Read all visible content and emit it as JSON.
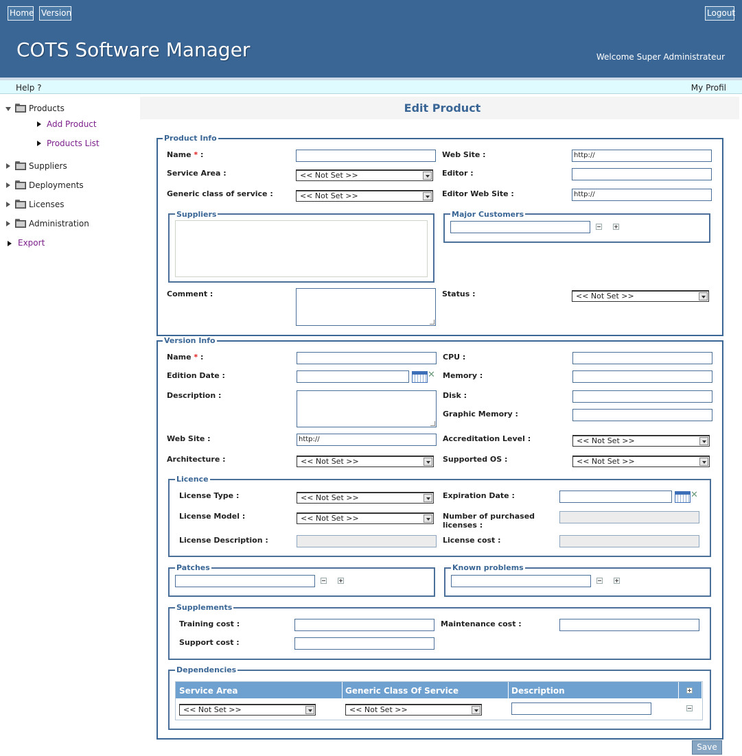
{
  "header": {
    "home_label": "Home",
    "version_label": "Version",
    "logout_label": "Logout",
    "app_title": "COTS Software Manager",
    "welcome_text": "Welcome Super Administrateur"
  },
  "subbar": {
    "help_label": "Help ?",
    "profile_label": "My Profil"
  },
  "sidebar": {
    "products": "Products",
    "add_product": "Add Product",
    "products_list": "Products List",
    "suppliers": "Suppliers",
    "deployments": "Deployments",
    "licenses": "Licenses",
    "administration": "Administration",
    "export": "Export"
  },
  "page_title": "Edit Product",
  "product_info": {
    "legend": "Product Info",
    "name_label": "Name",
    "required_mark": "*",
    "colon": ":",
    "web_site_label": "Web Site :",
    "web_site_value": "http://",
    "service_area_label": "Service Area :",
    "service_area_value": "<< Not Set >>",
    "editor_label": "Editor :",
    "generic_class_label": "Generic class of service :",
    "generic_class_value": "<< Not Set >>",
    "editor_web_site_label": "Editor Web Site :",
    "editor_web_site_value": "http://",
    "suppliers_legend": "Suppliers",
    "major_customers_legend": "Major Customers",
    "comment_label": "Comment :",
    "status_label": "Status :",
    "status_value": "<< Not Set >>"
  },
  "version_info": {
    "legend": "Version Info",
    "name_label": "Name",
    "required_mark": "*",
    "colon": ":",
    "cpu_label": "CPU :",
    "edition_date_label": "Edition Date :",
    "memory_label": "Memory :",
    "description_label": "Description :",
    "disk_label": "Disk :",
    "graphic_memory_label": "Graphic Memory :",
    "web_site_label": "Web Site :",
    "web_site_value": "http://",
    "accreditation_label": "Accreditation Level :",
    "accreditation_value": "<< Not Set >>",
    "architecture_label": "Architecture :",
    "architecture_value": "<< Not Set >>",
    "supported_os_label": "Supported OS :",
    "supported_os_value": "<< Not Set >>"
  },
  "licence": {
    "legend": "Licence",
    "license_type_label": "License Type :",
    "license_type_value": "<< Not Set >>",
    "expiration_date_label": "Expiration Date :",
    "license_model_label": "License Model :",
    "license_model_value": "<< Not Set >>",
    "purchased_label_1": "Number of purchased",
    "purchased_label_2": "licenses :",
    "license_description_label": "License Description :",
    "license_cost_label": "License cost :"
  },
  "patches": {
    "legend": "Patches"
  },
  "known_problems": {
    "legend": "Known problems"
  },
  "supplements": {
    "legend": "Supplements",
    "training_cost_label": "Training cost :",
    "maintenance_cost_label": "Maintenance cost :",
    "support_cost_label": "Support cost :"
  },
  "dependencies": {
    "legend": "Dependencies",
    "columns": [
      "Service Area",
      "Generic Class Of Service",
      "Description"
    ],
    "row": {
      "service_area_value": "<< Not Set >>",
      "generic_class_value": "<< Not Set >>"
    }
  },
  "save_label": "Save",
  "icons": {
    "expand": "plus-icon",
    "collapse": "minus-icon",
    "calendar": "calendar-icon",
    "clear_date": "clear-date-icon",
    "folder": "folder-icon"
  },
  "colors": {
    "header_bg": "#3a6696",
    "accent": "#3a6696",
    "subbar_bg": "#e0fbff",
    "table_head": "#6ea0d0",
    "link": "#7b1f8a"
  }
}
